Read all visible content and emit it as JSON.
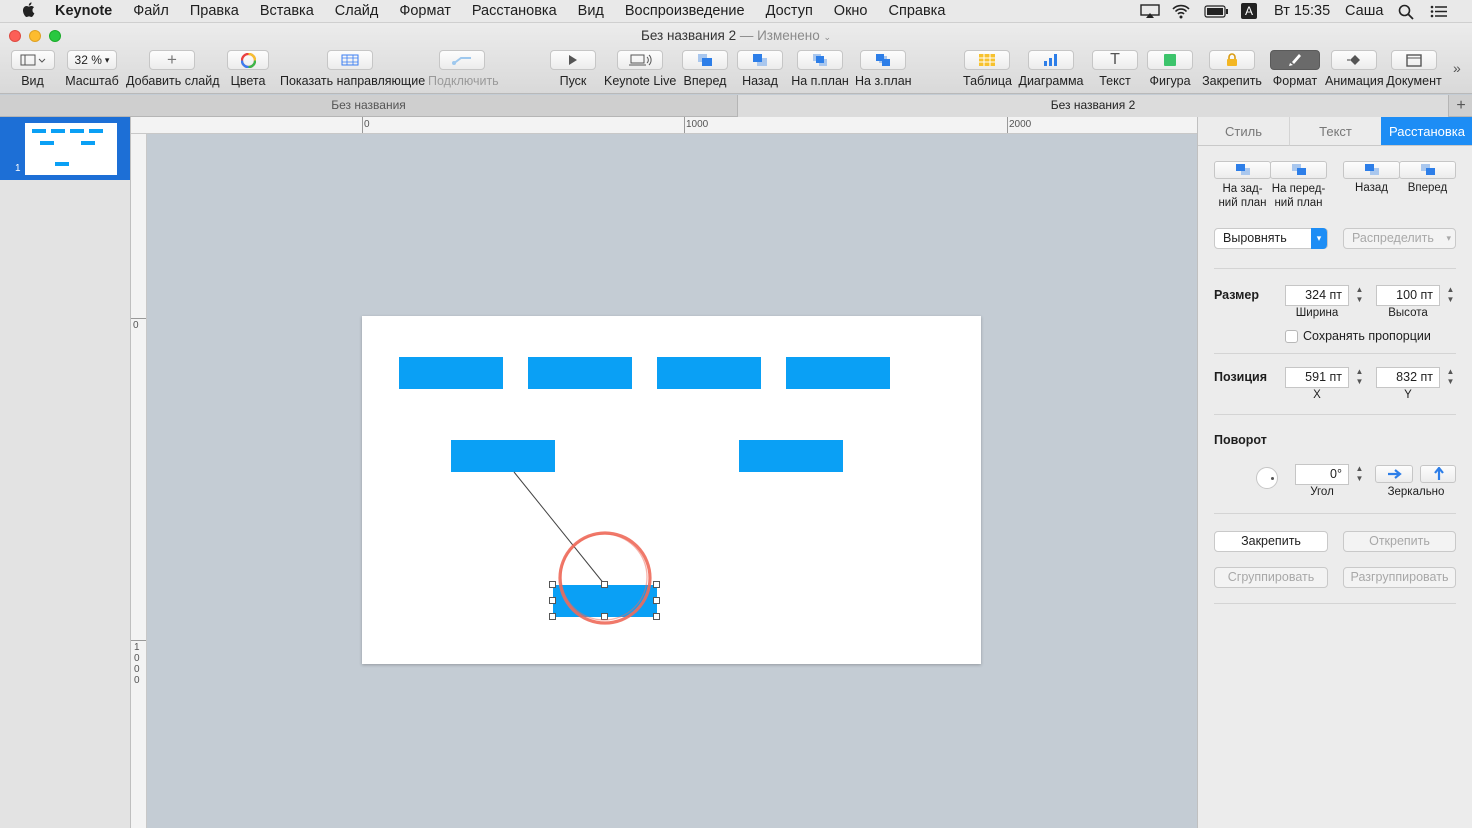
{
  "menubar": {
    "apple": "",
    "app": "Keynote",
    "items": [
      "Файл",
      "Правка",
      "Вставка",
      "Слайд",
      "Формат",
      "Расстановка",
      "Вид",
      "Воспроизведение",
      "Доступ",
      "Окно",
      "Справка"
    ],
    "status": {
      "input": "A",
      "clock": "Вт 15:35",
      "user": "Саша"
    }
  },
  "window": {
    "title": "Без названия 2",
    "modified": "— Изменено"
  },
  "toolbar": {
    "view": "Вид",
    "zoom_value": "32 %",
    "zoom": "Масштаб",
    "add_slide": "Добавить слайд",
    "colors": "Цвета",
    "show_guides": "Показать направляющие",
    "connect": "Подключить",
    "play": "Пуск",
    "keynote_live": "Keynote Live",
    "forward": "Вперед",
    "backward": "Назад",
    "to_front": "На п.план",
    "to_back": "На з.план",
    "table": "Таблица",
    "chart": "Диаграмма",
    "text": "Текст",
    "shape": "Фигура",
    "lock": "Закрепить",
    "format": "Формат",
    "animate": "Анимация",
    "document": "Документ"
  },
  "tabs": [
    "Без названия",
    "Без названия 2"
  ],
  "navigator": {
    "slide_number": "1"
  },
  "rulers": {
    "h": [
      "0",
      "1000",
      "2000"
    ],
    "v0": "0",
    "v1000": "1 0 0 0"
  },
  "inspector": {
    "tabs": [
      "Стиль",
      "Текст",
      "Расстановка"
    ],
    "active_tab": "Расстановка",
    "layer_buttons": [
      "На зад-\nний план",
      "На перед-\nний план",
      "Назад",
      "Вперед"
    ],
    "align": "Выровнять",
    "distribute": "Распределить",
    "size": {
      "label": "Размер",
      "width": "324 пт",
      "height": "100 пт",
      "width_label": "Ширина",
      "height_label": "Высота",
      "constrain": "Сохранять пропорции"
    },
    "position": {
      "label": "Позиция",
      "x": "591 пт",
      "y": "832 пт",
      "x_label": "X",
      "y_label": "Y"
    },
    "rotate": {
      "label": "Поворот",
      "angle": "0°",
      "angle_label": "Угол",
      "flip_label": "Зеркально"
    },
    "lock": "Закрепить",
    "unlock": "Открепить",
    "group": "Сгруппировать",
    "ungroup": "Разгруппировать"
  },
  "colors": {
    "accent": "#1d8df5",
    "shape": "#0aa0f5",
    "highlight": "#ee6a5a"
  }
}
